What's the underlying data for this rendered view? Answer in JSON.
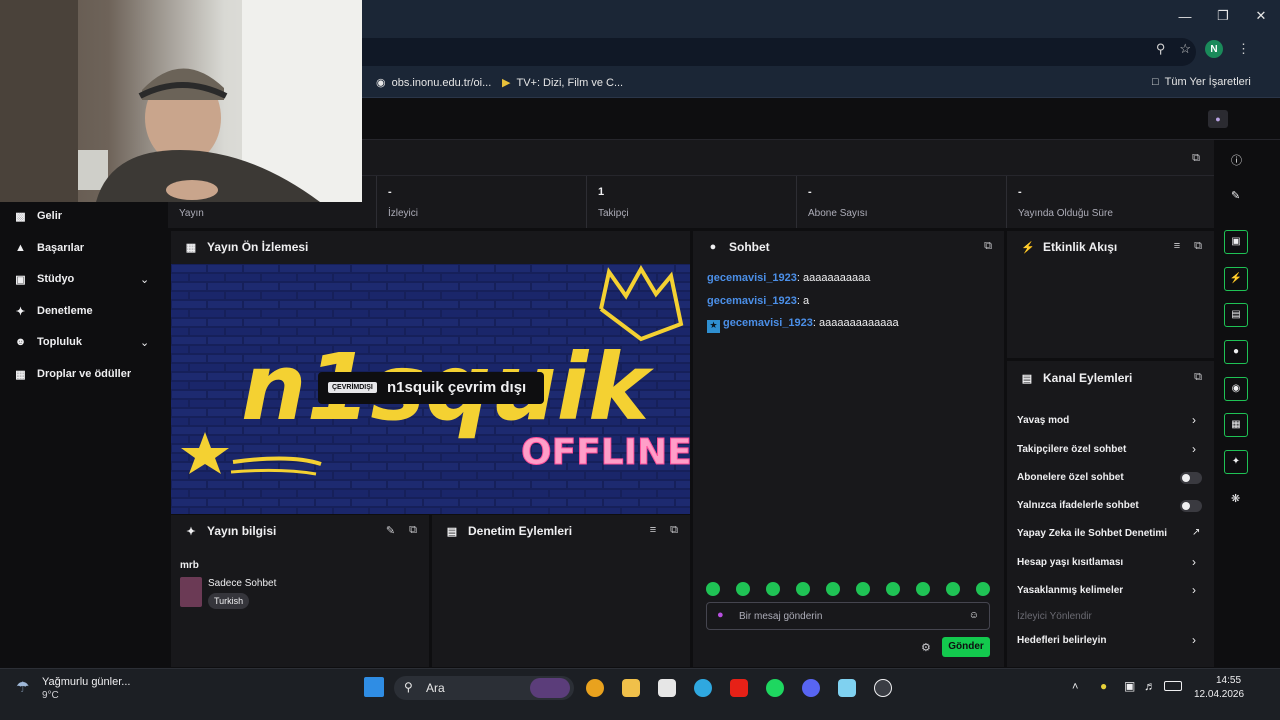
{
  "browser": {
    "bookmarks": [
      {
        "label": "obs.inonu.edu.tr/oi...",
        "icon": "globe-icon"
      },
      {
        "label": "TV+: Dizi, Film ve C...",
        "icon": "tv-icon"
      },
      {
        "label": "Tüm Yer İşaretleri",
        "icon": "folder-icon"
      }
    ],
    "profile_initial": "N"
  },
  "nav": {
    "items": [
      {
        "label": "Gelir",
        "icon": "chart-icon"
      },
      {
        "label": "Başarılar",
        "icon": "trophy-icon"
      },
      {
        "label": "Stüdyo",
        "icon": "studio-icon",
        "expandable": true
      },
      {
        "label": "Denetleme",
        "icon": "wrench-icon"
      },
      {
        "label": "Topluluk",
        "icon": "community-icon",
        "expandable": true
      },
      {
        "label": "Droplar ve ödüller",
        "icon": "gift-icon"
      }
    ]
  },
  "stats": [
    {
      "value": "",
      "label": "Yayın"
    },
    {
      "value": "-",
      "label": "İzleyici"
    },
    {
      "value": "1",
      "label": "Takipçi"
    },
    {
      "value": "-",
      "label": "Abone Sayısı"
    },
    {
      "value": "-",
      "label": "Yayında Olduğu Süre"
    }
  ],
  "preview": {
    "title": "Yayın Ön İzlemesi",
    "offline_badge": "ÇEVRİMDIŞI",
    "offline_text": "n1squik çevrim dışı",
    "art_text": "n1squik",
    "art_offline": "OFFLINE"
  },
  "stream_info": {
    "title": "Yayın bilgisi",
    "stream_title": "mrb",
    "category": "Sadece Sohbet",
    "tag": "Turkish"
  },
  "moderation": {
    "title": "Denetim Eylemleri"
  },
  "chat": {
    "title": "Sohbet",
    "messages": [
      {
        "user": "gecemavisi_1923",
        "text": ": aaaaaaaaaaa",
        "badge": false
      },
      {
        "user": "gecemavisi_1923",
        "text": ": a",
        "badge": false
      },
      {
        "user": "gecemavisi_1923",
        "text": ": aaaaaaaaaaaaa",
        "badge": true
      }
    ],
    "placeholder": "Bir mesaj gönderin",
    "send_label": "Gönder"
  },
  "activity": {
    "title": "Etkinlik Akışı"
  },
  "channel_actions": {
    "title": "Kanal Eylemleri",
    "items": [
      {
        "label": "Yavaş mod",
        "control": "chevron"
      },
      {
        "label": "Takipçilere özel sohbet",
        "control": "chevron"
      },
      {
        "label": "Abonelere özel sohbet",
        "control": "toggle",
        "enabled": false
      },
      {
        "label": "Yalnızca ifadelerle sohbet",
        "control": "toggle",
        "enabled": false
      },
      {
        "label": "Yapay Zeka ile Sohbet Denetimi",
        "control": "external"
      },
      {
        "label": "Hesap yaşı kısıtlaması",
        "control": "chevron"
      },
      {
        "label": "Yasaklanmış kelimeler",
        "control": "chevron"
      },
      {
        "label": "İzleyici Yönlendir",
        "control": "none",
        "disabled": true
      },
      {
        "label": "Hedefleri belirleyin",
        "control": "chevron"
      }
    ]
  },
  "taskbar": {
    "weather_text": "Yağmurlu günler...",
    "temperature": "9°C",
    "search_label": "Ara",
    "time": "14:55",
    "date": "12.04.2026"
  },
  "colors": {
    "accent": "#1fc255",
    "username": "#4b8fe8",
    "panel_bg": "#18181b",
    "page_bg": "#0e0e10"
  }
}
